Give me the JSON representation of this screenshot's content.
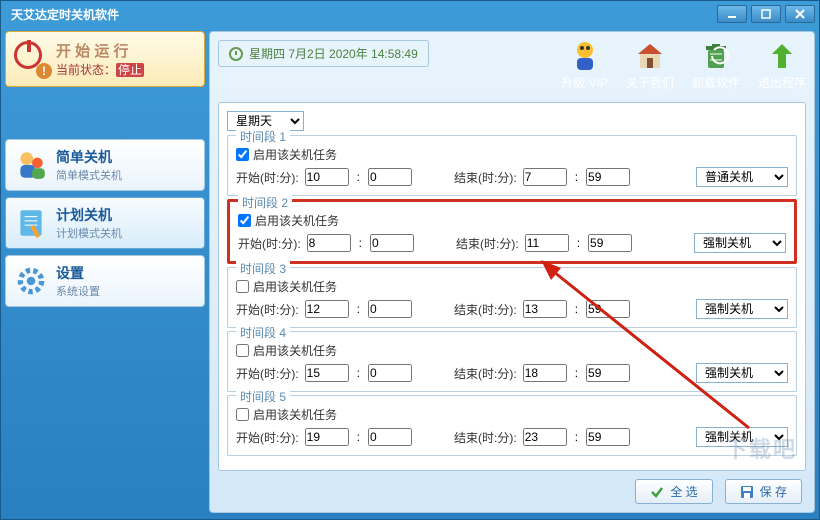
{
  "window": {
    "title": "天艾达定时关机软件"
  },
  "run": {
    "title": "开 始 运 行",
    "status_prefix": "当前状态：",
    "status_value": "停止"
  },
  "nav": {
    "items": [
      {
        "title": "简单关机",
        "sub": "简单模式关机"
      },
      {
        "title": "计划关机",
        "sub": "计划模式关机"
      },
      {
        "title": "设置",
        "sub": "系统设置"
      }
    ]
  },
  "datetime": "星期四 7月2日 2020年 14:58:49",
  "toolbar": {
    "vip": "升级 VIP",
    "about": "关于我们",
    "uninstall": "卸载软件",
    "exit": "退出程序"
  },
  "form": {
    "day": "星期天",
    "enable_label": "启用该关机任务",
    "start_label": "开始(时:分):",
    "end_label": "结束(时:分):",
    "sections": [
      {
        "legend": "时间段 1",
        "enabled": true,
        "sh": "10",
        "sm": "0",
        "eh": "7",
        "em": "59",
        "type": "普通关机"
      },
      {
        "legend": "时间段 2",
        "enabled": true,
        "sh": "8",
        "sm": "0",
        "eh": "11",
        "em": "59",
        "type": "强制关机",
        "highlight": true
      },
      {
        "legend": "时间段 3",
        "enabled": false,
        "sh": "12",
        "sm": "0",
        "eh": "13",
        "em": "59",
        "type": "强制关机"
      },
      {
        "legend": "时间段 4",
        "enabled": false,
        "sh": "15",
        "sm": "0",
        "eh": "18",
        "em": "59",
        "type": "强制关机"
      },
      {
        "legend": "时间段 5",
        "enabled": false,
        "sh": "19",
        "sm": "0",
        "eh": "23",
        "em": "59",
        "type": "强制关机"
      }
    ]
  },
  "buttons": {
    "select_all": "全 选",
    "save": "保 存"
  },
  "watermark": "下载吧"
}
